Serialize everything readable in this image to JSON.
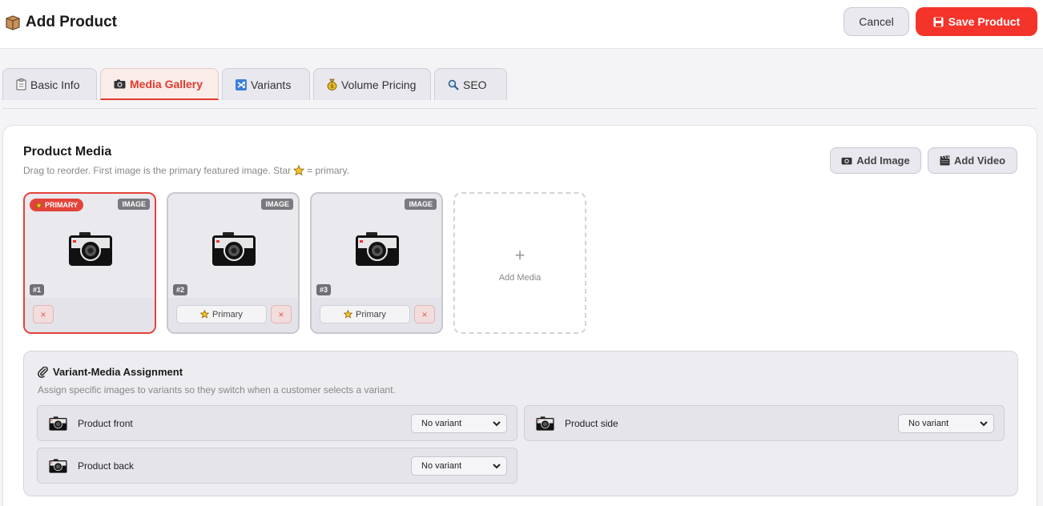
{
  "header": {
    "title": "Add Product",
    "cancel_label": "Cancel",
    "save_label": "Save Product"
  },
  "tabs": [
    {
      "label": "Basic Info",
      "icon": "clipboard-icon"
    },
    {
      "label": "Media Gallery",
      "icon": "camera-icon",
      "active": true
    },
    {
      "label": "Variants",
      "icon": "shuffle-icon"
    },
    {
      "label": "Volume Pricing",
      "icon": "money-bag-icon"
    },
    {
      "label": "SEO",
      "icon": "magnifier-icon"
    }
  ],
  "media": {
    "title": "Product Media",
    "subtitle_before": "Drag to reorder. First image is the primary featured image. Star",
    "subtitle_after": "= primary.",
    "add_image_label": "Add Image",
    "add_video_label": "Add Video",
    "primary_badge": "PRIMARY",
    "cards": [
      {
        "type": "IMAGE",
        "number": "#1"
      },
      {
        "type": "IMAGE",
        "number": "#2",
        "primary_button": "Primary"
      },
      {
        "type": "IMAGE",
        "number": "#3",
        "primary_button": "Primary"
      }
    ],
    "remove_label": "×",
    "add_media_label": "Add Media",
    "add_media_plus": "+"
  },
  "variant_media": {
    "title": "Variant-Media Assignment",
    "subtitle": "Assign specific images to variants so they switch when a customer selects a variant.",
    "rows": [
      {
        "name": "Product front",
        "selected": "No variant"
      },
      {
        "name": "Product side",
        "selected": "No variant"
      },
      {
        "name": "Product back",
        "selected": "No variant"
      }
    ]
  },
  "colors": {
    "accent": "#f4342b",
    "active_tab_text": "#e23b2e",
    "primary_border": "#e3433a"
  }
}
